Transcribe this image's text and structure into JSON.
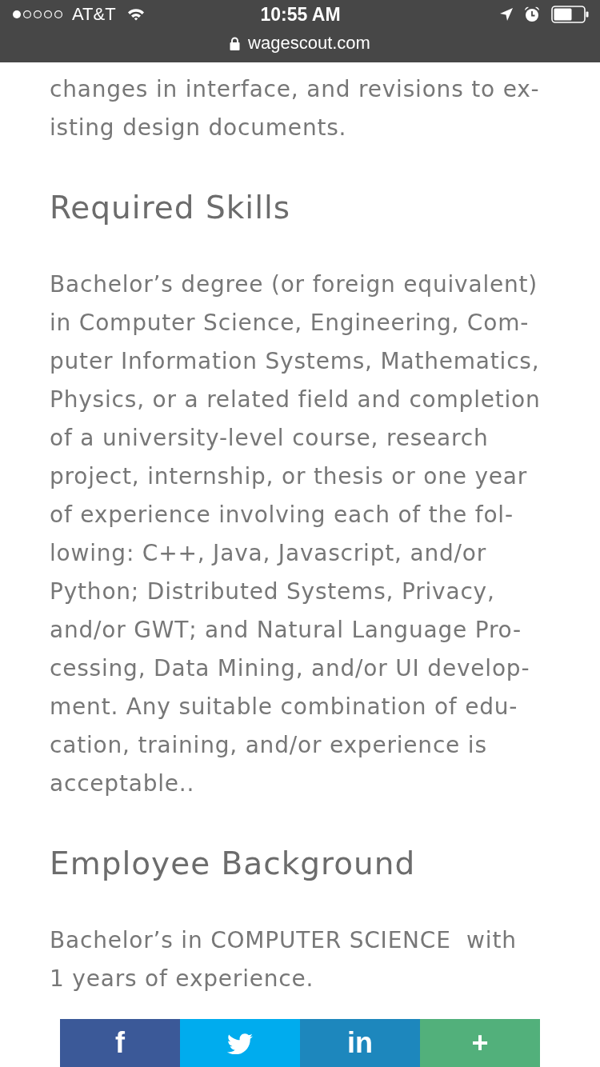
{
  "status_bar": {
    "carrier": "AT&T",
    "time": "10:55 AM"
  },
  "address_bar": {
    "url": "wagescout.com",
    "secure": true
  },
  "article": [
    {
      "kind": "paragraph",
      "lines": [
        "changes in interface, and revisions to ex-",
        "isting design documents."
      ]
    },
    {
      "kind": "heading",
      "text": "Required Skills"
    },
    {
      "kind": "paragraph",
      "lines": [
        "Bachelor’s degree (or foreign equivalent)",
        "in Computer Science, Engineering, Com-",
        "puter Information Systems, Mathematics,",
        "Physics, or a related field and completion",
        "of a university-level course, research",
        "project, internship, or thesis or one year",
        "of experience involving each of the fol-",
        "lowing: C++, Java, Javascript, and/or",
        "Python; Distributed Systems, Privacy,",
        "and/or GWT; and Natural Language Pro-",
        "cessing, Data Mining, and/or UI develop-",
        "ment. Any suitable combination of edu-",
        "cation, training, and/or experience is",
        "acceptable.."
      ]
    },
    {
      "kind": "heading",
      "text": "Employee Background"
    },
    {
      "kind": "paragraph",
      "lines": [
        "Bachelor’s in COMPUTER SCIENCE  with",
        "1 years of experience."
      ]
    }
  ],
  "share_bar": {
    "buttons": [
      {
        "kind": "glyph",
        "label": "f",
        "color": "#3b5998"
      },
      {
        "kind": "bird",
        "color": "#00acee"
      },
      {
        "kind": "glyph",
        "label": "in",
        "color": "#1d87bd"
      },
      {
        "kind": "glyph",
        "label": "+",
        "color": "#52b07b"
      }
    ]
  }
}
